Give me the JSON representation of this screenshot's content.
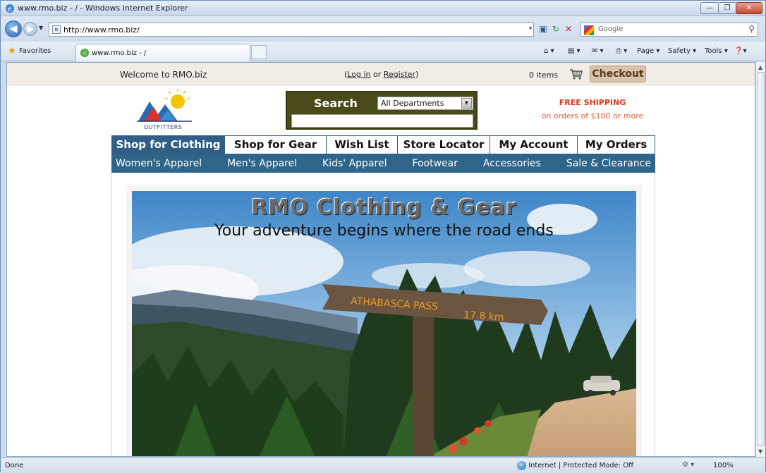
{
  "window": {
    "title": "www.rmo.biz - / - Windows Internet Explorer",
    "minimize": "—",
    "maximize": "❐",
    "close": "✕"
  },
  "address_bar": {
    "url": "http://www.rmo.biz/",
    "search_placeholder": "Google",
    "refresh": "↻",
    "stop": "✕",
    "compat": "▣",
    "dropdown": "▾"
  },
  "favorites_bar": {
    "favorites_label": "Favorites",
    "tab_label": "www.rmo.biz - /",
    "commands": {
      "page": "Page ▾",
      "safety": "Safety ▾",
      "tools": "Tools ▾",
      "help": "❓▾"
    }
  },
  "site": {
    "welcome": "Welcome to RMO.biz",
    "login": "Log in",
    "or": " or ",
    "register": "Register",
    "items": "0 items",
    "checkout": "Checkout",
    "logo_text": "OUTFITTERS",
    "search_label": "Search",
    "department": "All Departments",
    "free_shipping_title": "FREE SHIPPING",
    "free_shipping_note": "on orders of $100 or more",
    "main_nav": [
      {
        "label": "Shop for Clothing",
        "active": true
      },
      {
        "label": "Shop for Gear",
        "active": false
      },
      {
        "label": "Wish List",
        "active": false
      },
      {
        "label": "Store Locator",
        "active": false
      },
      {
        "label": "My Account",
        "active": false
      },
      {
        "label": "My Orders",
        "active": false
      }
    ],
    "sub_nav": [
      "Women's Apparel",
      "Men's Apparel",
      "Kids' Apparel",
      "Footwear",
      "Accessories",
      "Sale & Clearance"
    ],
    "hero_title": "RMO Clothing & Gear",
    "hero_tagline": "Your adventure begins where the road ends",
    "sign_line1": "ATHABASCA PASS",
    "sign_line2": "17.8 km"
  },
  "status_bar": {
    "status": "Done",
    "zone": "Internet | Protected Mode: Off",
    "zoom": "100%"
  },
  "colors": {
    "nav_blue": "#2f5f86",
    "search_olive": "#4a4a1a",
    "free_shipping": "#d93a1a",
    "checkout_bg": "#d8c3ad"
  }
}
